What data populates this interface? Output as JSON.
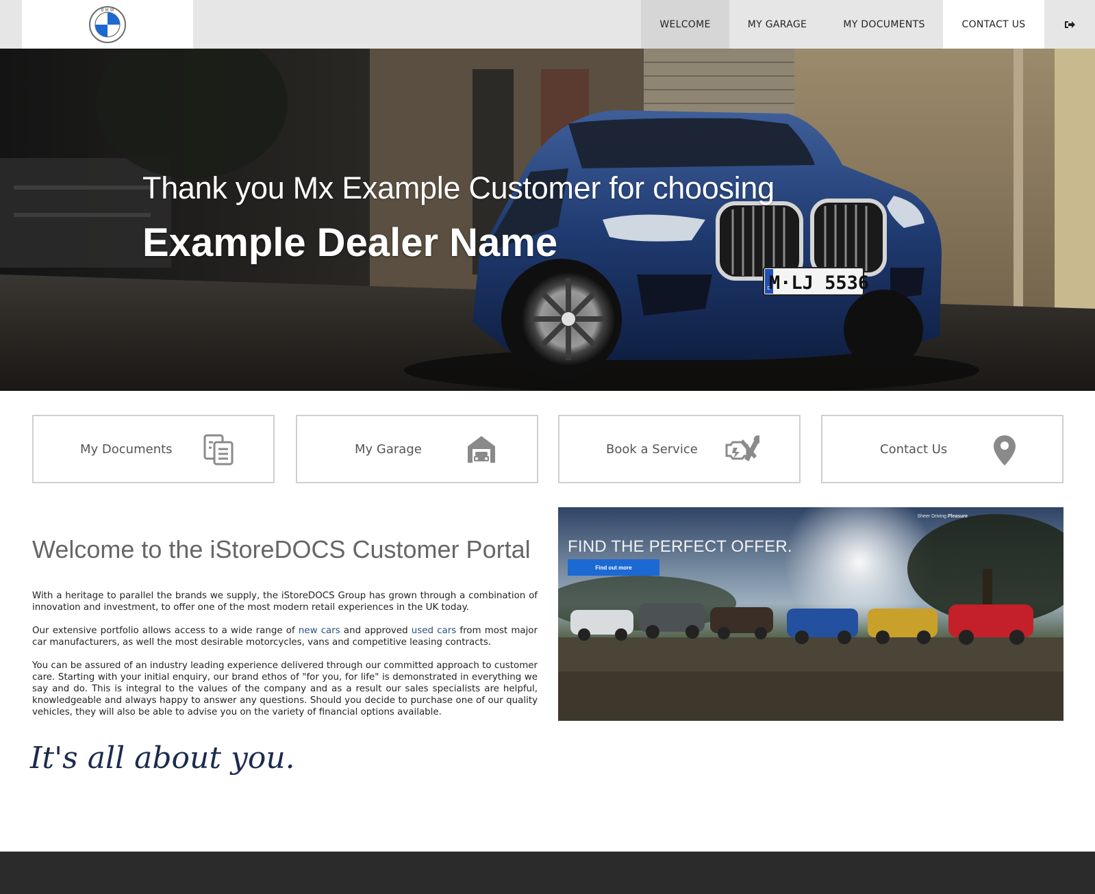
{
  "nav": {
    "logo_text": "B M W",
    "items": [
      {
        "label": "WELCOME",
        "active": true
      },
      {
        "label": "MY GARAGE"
      },
      {
        "label": "MY DOCUMENTS"
      },
      {
        "label": "CONTACT US"
      }
    ],
    "logout_icon": "sign-out-icon"
  },
  "hero": {
    "line1": "Thank you Mx Example Customer for choosing",
    "line2": "Example Dealer Name",
    "plate": "M·LJ 5536",
    "plate_country": "D"
  },
  "tiles": [
    {
      "label": "My Documents",
      "icon": "documents-icon"
    },
    {
      "label": "My Garage",
      "icon": "garage-icon"
    },
    {
      "label": "Book a Service",
      "icon": "service-tools-icon"
    },
    {
      "label": "Contact Us",
      "icon": "map-pin-icon"
    }
  ],
  "welcome": {
    "title": "Welcome to the iStoreDOCS Customer Portal",
    "p1": "With a heritage to parallel the brands we supply, the iStoreDOCS Group has grown through a combination of innovation and investment, to offer one of the most modern retail experiences in the UK today.",
    "p2_before": "Our extensive portfolio allows access to a wide range of ",
    "p2_link1": "new cars",
    "p2_mid": " and approved ",
    "p2_link2": "used cars",
    "p2_after": " from most major car manufacturers, as well the most desirable motorcycles, vans and competitive leasing contracts.",
    "p3": "You can be assured of an industry leading experience delivered through our committed approach to customer care. Starting with your initial enquiry, our brand ethos of \"for you, for life\" is demonstrated in everything we say and do. This is integral to the values of the company and as a result our sales specialists are helpful, knowledgeable and always happy to answer any questions. Should you decide to purchase one of our quality vehicles, they will also be able to advise you on the variety of financial options available.",
    "tagline": "It's all about you."
  },
  "offer": {
    "title": "FIND THE PERFECT OFFER.",
    "button": "Find out more",
    "badge_prefix": "Sheer Driving ",
    "badge_bold": "Pleasure"
  },
  "colors": {
    "nav_bg": "#e6e6e6",
    "nav_active": "#d6d6d6",
    "footer": "#2b2b2b",
    "tile_border": "#cfcfcf",
    "link": "#2c4d7a",
    "offer_button": "#1c69d4",
    "tagline": "#1c2a4d"
  }
}
